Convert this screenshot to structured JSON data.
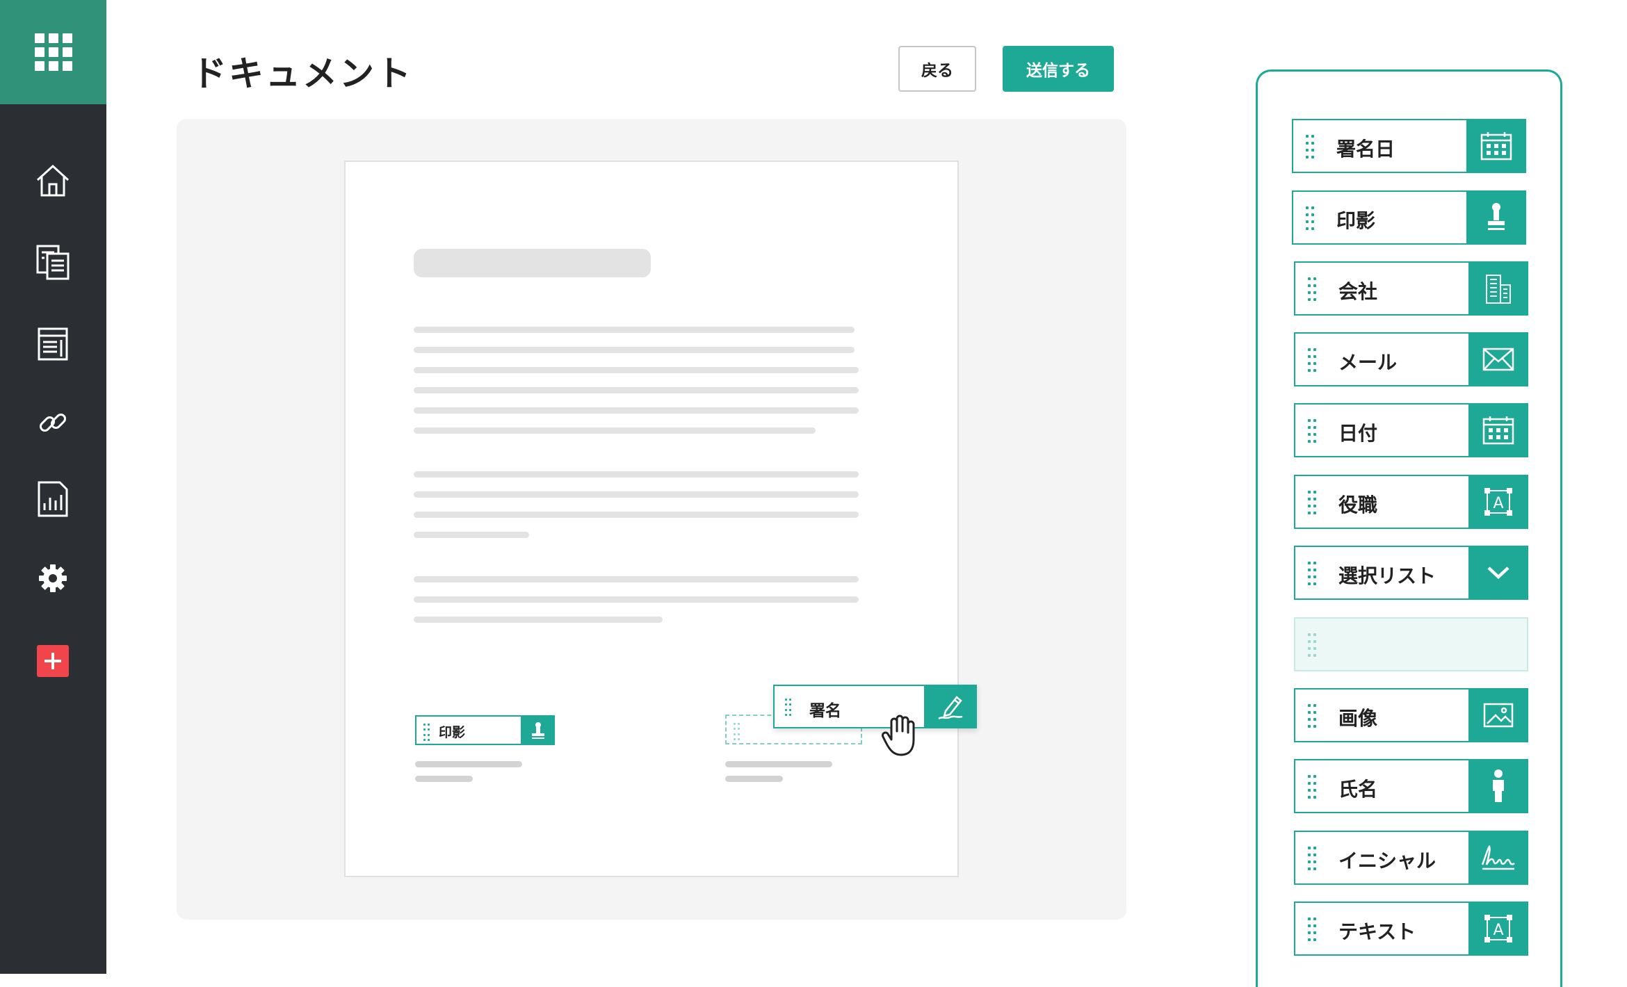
{
  "page": {
    "title": "ドキュメント"
  },
  "header": {
    "back_label": "戻る",
    "send_label": "送信する"
  },
  "sidebar": {
    "items": [
      {
        "icon": "apps-grid-icon"
      },
      {
        "icon": "home-icon"
      },
      {
        "icon": "documents-icon"
      },
      {
        "icon": "templates-icon"
      },
      {
        "icon": "link-icon"
      },
      {
        "icon": "report-icon"
      },
      {
        "icon": "gear-icon"
      },
      {
        "icon": "plus-icon"
      }
    ]
  },
  "document": {
    "placed_fields": [
      {
        "label": "印影",
        "icon": "stamp-icon"
      },
      {
        "label": "署名",
        "icon": "signature-pen-icon"
      }
    ]
  },
  "field_panel": {
    "items": [
      {
        "label": "署名日",
        "icon": "calendar-icon"
      },
      {
        "label": "印影",
        "icon": "stamp-icon"
      },
      {
        "label": "会社",
        "icon": "building-icon"
      },
      {
        "label": "メール",
        "icon": "mail-icon"
      },
      {
        "label": "日付",
        "icon": "calendar-icon"
      },
      {
        "label": "役職",
        "icon": "text-box-icon"
      },
      {
        "label": "選択リスト",
        "icon": "chevron-down-icon"
      },
      {
        "label": "",
        "icon": ""
      },
      {
        "label": "画像",
        "icon": "image-icon"
      },
      {
        "label": "氏名",
        "icon": "person-icon"
      },
      {
        "label": "イニシャル",
        "icon": "initials-icon"
      },
      {
        "label": "テキスト",
        "icon": "text-box-icon"
      }
    ]
  },
  "colors": {
    "accent": "#1ea996",
    "sidebar": "#2b2f33",
    "logo_tile": "#2f9279",
    "add_button": "#f0464b"
  }
}
